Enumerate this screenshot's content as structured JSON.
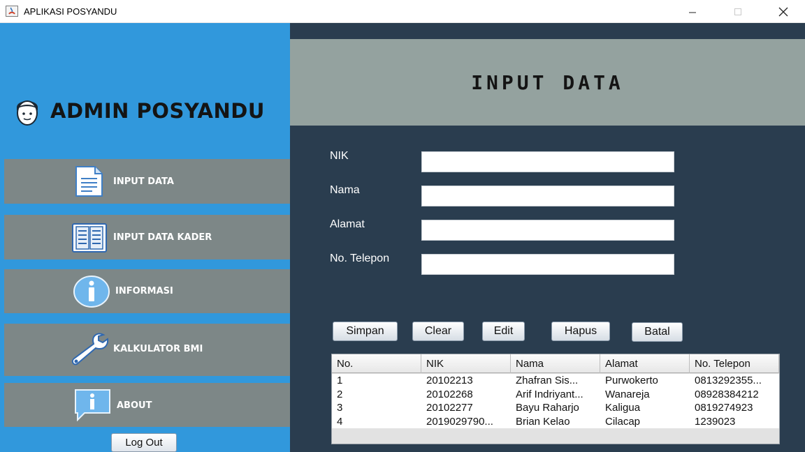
{
  "window": {
    "title": "APLIKASI POSYANDU"
  },
  "sidebar": {
    "brand": "ADMIN POSYANDU",
    "items": [
      {
        "label": "INPUT DATA",
        "icon": "document-icon"
      },
      {
        "label": "INPUT DATA KADER",
        "icon": "book-icon"
      },
      {
        "label": "INFORMASI",
        "icon": "info-icon"
      },
      {
        "label": "KALKULATOR BMI",
        "icon": "wrench-icon"
      },
      {
        "label": "ABOUT",
        "icon": "about-bubble-icon"
      }
    ],
    "logout_label": "Log Out"
  },
  "main": {
    "title": "INPUT DATA",
    "form": {
      "nik_label": "NIK",
      "nama_label": "Nama",
      "alamat_label": "Alamat",
      "telepon_label": "No. Telepon",
      "nik_value": "",
      "nama_value": "",
      "alamat_value": "",
      "telepon_value": ""
    },
    "buttons": {
      "simpan": "Simpan",
      "clear": "Clear",
      "edit": "Edit",
      "hapus": "Hapus",
      "batal": "Batal"
    },
    "table": {
      "columns": [
        "No.",
        "NIK",
        "Nama",
        "Alamat",
        "No. Telepon"
      ],
      "rows": [
        [
          "1",
          "20102213",
          "Zhafran Sis...",
          "Purwokerto",
          "0813292355..."
        ],
        [
          "2",
          "20102268",
          "Arif Indriyant...",
          "Wanareja",
          "08928384212"
        ],
        [
          "3",
          "20102277",
          "Bayu Raharjo",
          "Kaligua",
          "0819274923"
        ],
        [
          "4",
          "2019029790...",
          "Brian Kelao",
          "Cilacap",
          "1239023"
        ]
      ]
    }
  },
  "colors": {
    "sidebar": "#3198dc",
    "menu_item": "#7d8787",
    "main_bg": "#2a3d4f",
    "header_band": "#94a29f"
  }
}
